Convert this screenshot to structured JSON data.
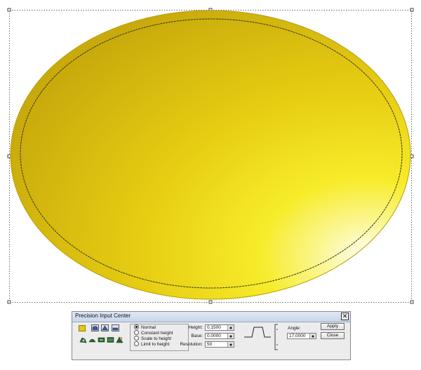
{
  "canvas": {
    "shape_color": "#f2dc18",
    "shape_edge_color": "#3a3520"
  },
  "dialog": {
    "title": "Precision Input Center",
    "close_glyph": "✕",
    "color_swatch": "#e8c90f",
    "modes": [
      {
        "label": "Normal",
        "selected": true
      },
      {
        "label": "Constant height",
        "selected": false
      },
      {
        "label": "Scale to height",
        "selected": false
      },
      {
        "label": "Limit to height",
        "selected": false
      }
    ],
    "height": {
      "label": "Height:",
      "value": "0.1500"
    },
    "base": {
      "label": "Base:",
      "value": "0.0000"
    },
    "resolution": {
      "label": "Resolution:",
      "value": "50"
    },
    "angle": {
      "label": "Angle:",
      "value": "17.0000"
    },
    "apply_label": "Apply",
    "close_label": "Close"
  }
}
